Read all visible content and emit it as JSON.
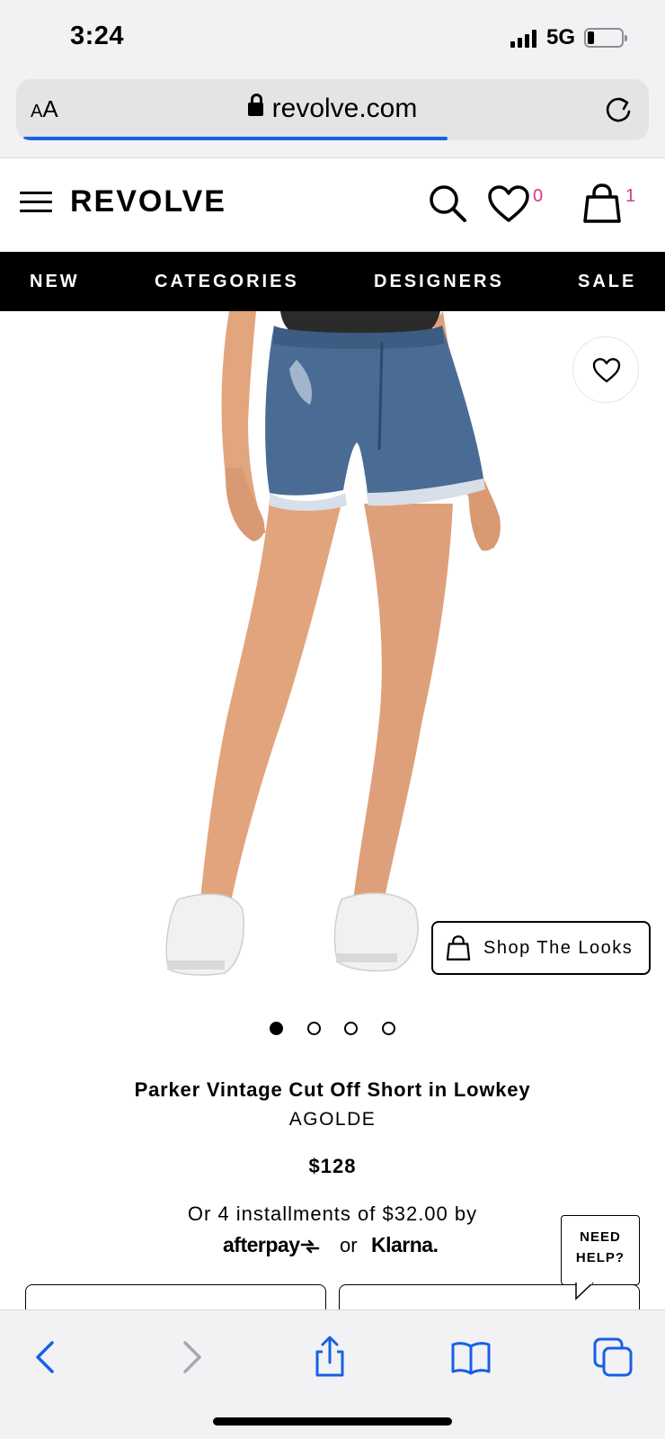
{
  "status_bar": {
    "time": "3:24",
    "network": "5G",
    "battery_level": 0.2
  },
  "browser": {
    "text_size_label_small": "A",
    "text_size_label_large": "A",
    "url": "revolve.com",
    "load_progress": 0.67,
    "accent_color": "#1860e6"
  },
  "header": {
    "logo": "REVOLVE",
    "wishlist_count": "0",
    "bag_count": "1",
    "count_color": "#d9368a"
  },
  "nav": {
    "items": [
      "NEW",
      "CATEGORIES",
      "DESIGNERS",
      "SALE"
    ]
  },
  "gallery": {
    "shop_the_looks": "Shop The Looks",
    "image_count": 4,
    "active_index": 0
  },
  "product": {
    "name": "Parker Vintage Cut Off Short in Lowkey",
    "brand": "AGOLDE",
    "price": "$128",
    "installments": "Or 4 installments of $32.00 by",
    "afterpay": "afterpay",
    "or": "or",
    "klarna": "Klarna."
  },
  "help": {
    "line1": "NEED",
    "line2": "HELP?"
  },
  "toolbar": {
    "icons": [
      "back-icon",
      "forward-icon",
      "share-icon",
      "bookmarks-icon",
      "tabs-icon"
    ]
  }
}
